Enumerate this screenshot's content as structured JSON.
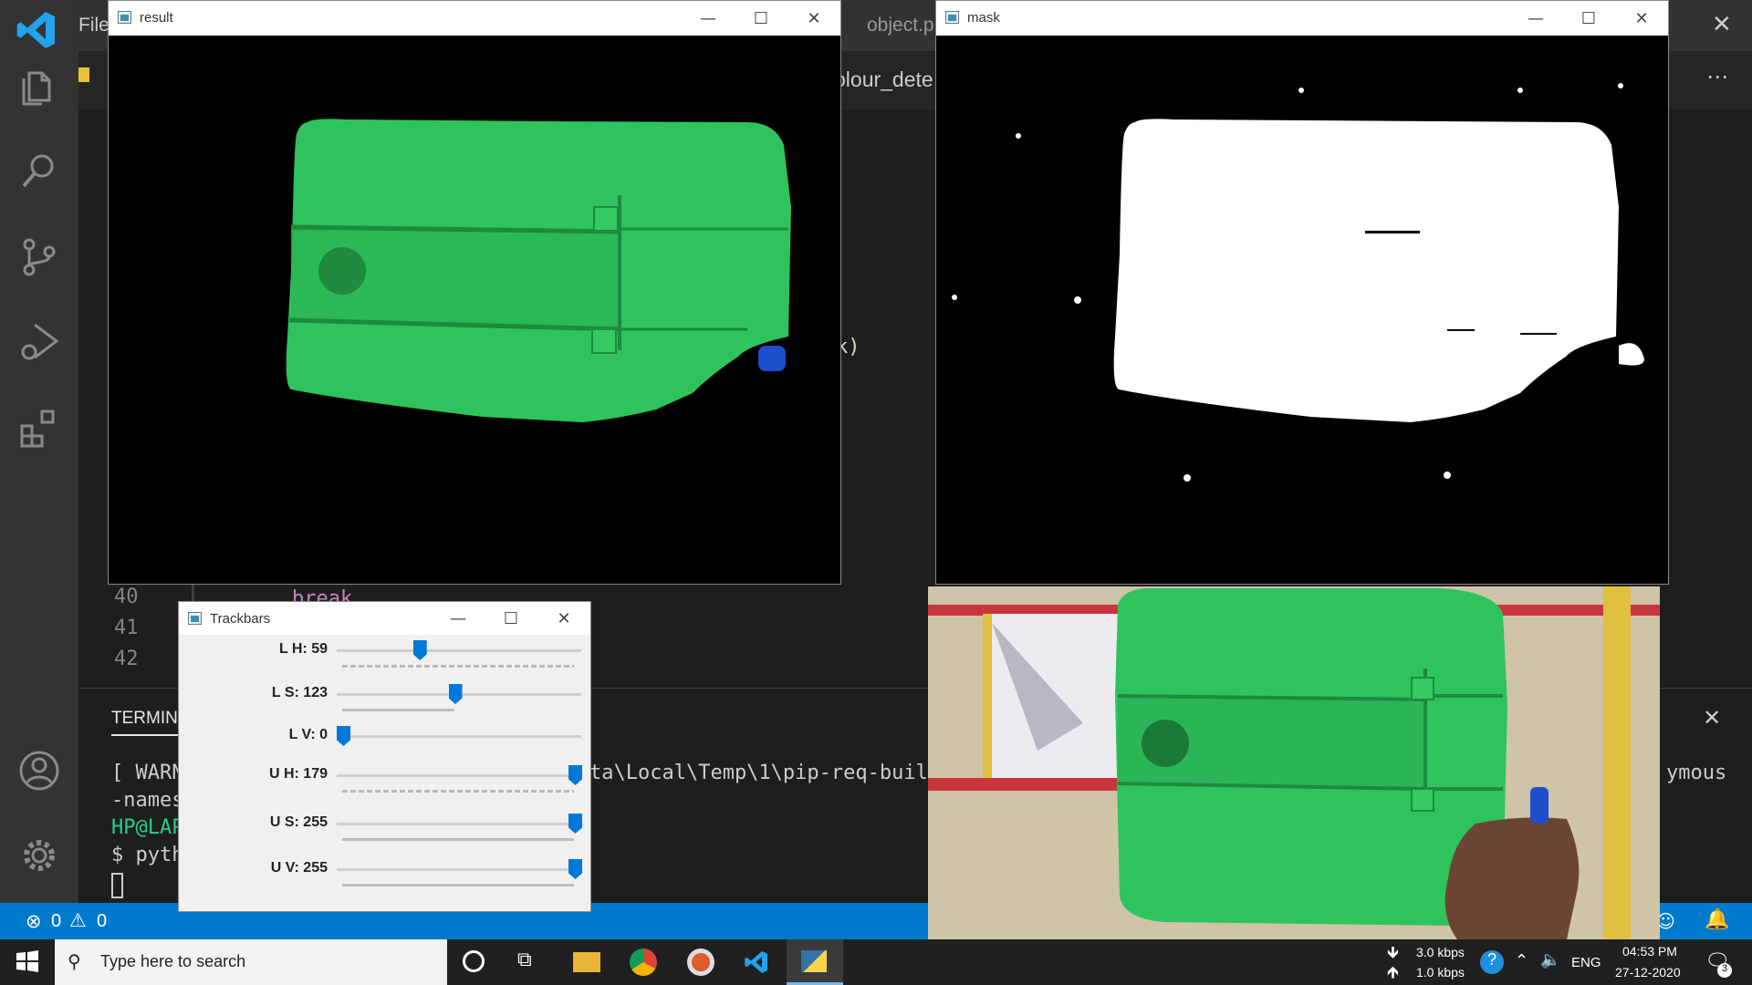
{
  "vscode": {
    "menu_file": "File",
    "tab_partial_1": "object.p",
    "tab_partial_2": "olour_dete",
    "editor_partial": "k)",
    "code_line40_text": "break",
    "line_numbers": [
      "40",
      "41",
      "42"
    ],
    "panel": {
      "tab_label": "TERMIN",
      "terminal_lines": [
        "[ WARN",
        "-names",
        "HP@LAP",
        "$ pyth"
      ],
      "terminal_overflow_text": "ta\\Local\\Temp\\1\\pip-req-build",
      "terminal_right_text": "ymous"
    },
    "status": {
      "errors": "0",
      "warnings": "0"
    }
  },
  "windows": {
    "result": {
      "title": "result"
    },
    "mask": {
      "title": "mask"
    },
    "trackbars": {
      "title": "Trackbars",
      "sliders": [
        {
          "label": "L  H: 59",
          "value": 59,
          "max": 179
        },
        {
          "label": "L  S: 123",
          "value": 123,
          "max": 255
        },
        {
          "label": "L  V: 0",
          "value": 0,
          "max": 255
        },
        {
          "label": "U  H: 179",
          "value": 179,
          "max": 179
        },
        {
          "label": "U  S: 255",
          "value": 255,
          "max": 255
        },
        {
          "label": "U  V: 255",
          "value": 255,
          "max": 255
        }
      ]
    }
  },
  "taskbar": {
    "search_placeholder": "Type here to search",
    "download_speed": "3.0 kbps",
    "upload_speed": "1.0 kbps",
    "language": "ENG",
    "time": "04:53 PM",
    "date": "27-12-2020",
    "notification_count": "3"
  },
  "colors": {
    "vscode_blue": "#007acc",
    "object_green": "#2fc35d",
    "slider_blue": "#0078d7"
  }
}
